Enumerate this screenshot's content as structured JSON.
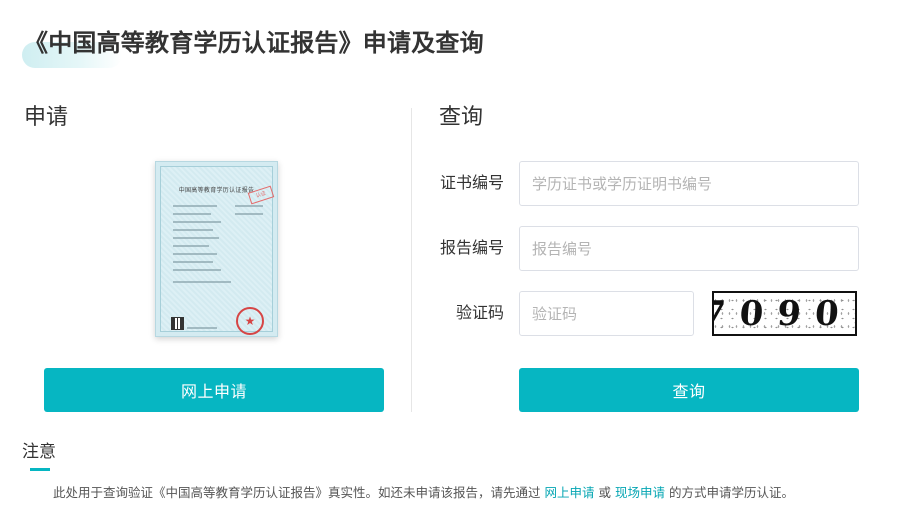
{
  "page": {
    "title": "《中国高等教育学历认证报告》申请及查询"
  },
  "apply": {
    "title": "申请",
    "button_label": "网上申请",
    "certificate": {
      "heading": "中国高等教育学历认证报告",
      "stamp_text": "认证"
    }
  },
  "query": {
    "title": "查询",
    "fields": {
      "cert_no": {
        "label": "证书编号",
        "placeholder": "学历证书或学历证明书编号",
        "value": ""
      },
      "report_no": {
        "label": "报告编号",
        "placeholder": "报告编号",
        "value": ""
      },
      "captcha": {
        "label": "验证码",
        "placeholder": "验证码",
        "value": ""
      }
    },
    "captcha_code": "7090.",
    "button_label": "查询"
  },
  "notice": {
    "title": "注意",
    "text_before": "此处用于查询验证《中国高等教育学历认证报告》真实性。如还未申请该报告，请先通过",
    "link_online": "网上申请",
    "text_or": "或",
    "link_onsite": "现场申请",
    "text_after": "的方式申请学历认证。"
  },
  "colors": {
    "accent": "#06b6c2",
    "link": "#06a6b3",
    "seal_red": "#d64545"
  },
  "icons": {
    "seal": "red-star-seal-icon",
    "qr": "qr-code-icon"
  }
}
